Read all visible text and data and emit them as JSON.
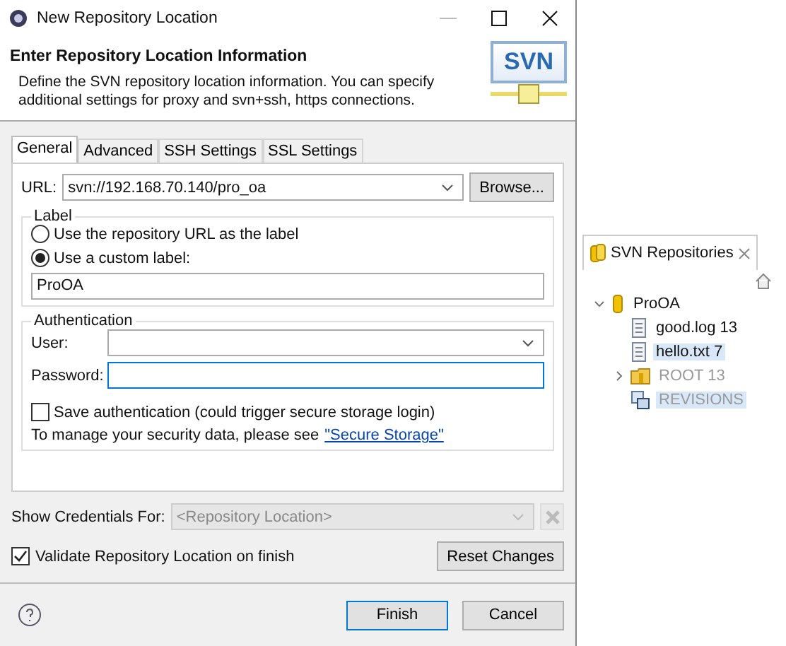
{
  "window": {
    "title": "New Repository Location"
  },
  "header": {
    "title": "Enter Repository Location Information",
    "description": "Define the SVN repository location information. You can specify additional settings for proxy and svn+ssh, https connections.",
    "logo": "SVN"
  },
  "tabs": [
    {
      "label": "General",
      "selected": true
    },
    {
      "label": "Advanced",
      "selected": false
    },
    {
      "label": "SSH Settings",
      "selected": false
    },
    {
      "label": "SSL Settings",
      "selected": false
    }
  ],
  "url": {
    "label": "URL:",
    "value": "svn://192.168.70.140/pro_oa",
    "button": "Browse..."
  },
  "label_group": {
    "title": "Label",
    "options": [
      {
        "label": "Use the repository URL as the label",
        "selected": false
      },
      {
        "label": "Use a custom label:",
        "selected": true
      }
    ],
    "custom_label": "ProOA"
  },
  "authentication": {
    "title": "Authentication",
    "user_label": "User:",
    "password_label": "Password:",
    "save": {
      "label": "Save authentication (could trigger secure storage login)",
      "checked": false
    },
    "note": "To manage your security data, please see",
    "link": "\"Secure Storage\""
  },
  "credentials": {
    "label": "Show Credentials For:",
    "value": "<Repository Location>",
    "disabled": true
  },
  "validate": {
    "label": "Validate Repository Location on finish",
    "checked": true
  },
  "reset_button": "Reset Changes",
  "buttons": [
    "Finish",
    "Cancel"
  ],
  "repositories_view": {
    "title": "SVN Repositories",
    "tree": [
      {
        "label": "ProOA",
        "kind": "repository",
        "expanded": true,
        "selected": false,
        "dimmed": false,
        "children": [
          {
            "label": "good.log 13",
            "kind": "file",
            "selected": false,
            "dimmed": false
          },
          {
            "label": "hello.txt 7",
            "kind": "file",
            "selected": true,
            "dimmed": false
          },
          {
            "label": "ROOT 13",
            "kind": "folder",
            "expanded": false,
            "selected": false,
            "dimmed": true
          },
          {
            "label": "REVISIONS",
            "kind": "revisions",
            "selected": true,
            "dimmed": true
          }
        ]
      }
    ]
  }
}
